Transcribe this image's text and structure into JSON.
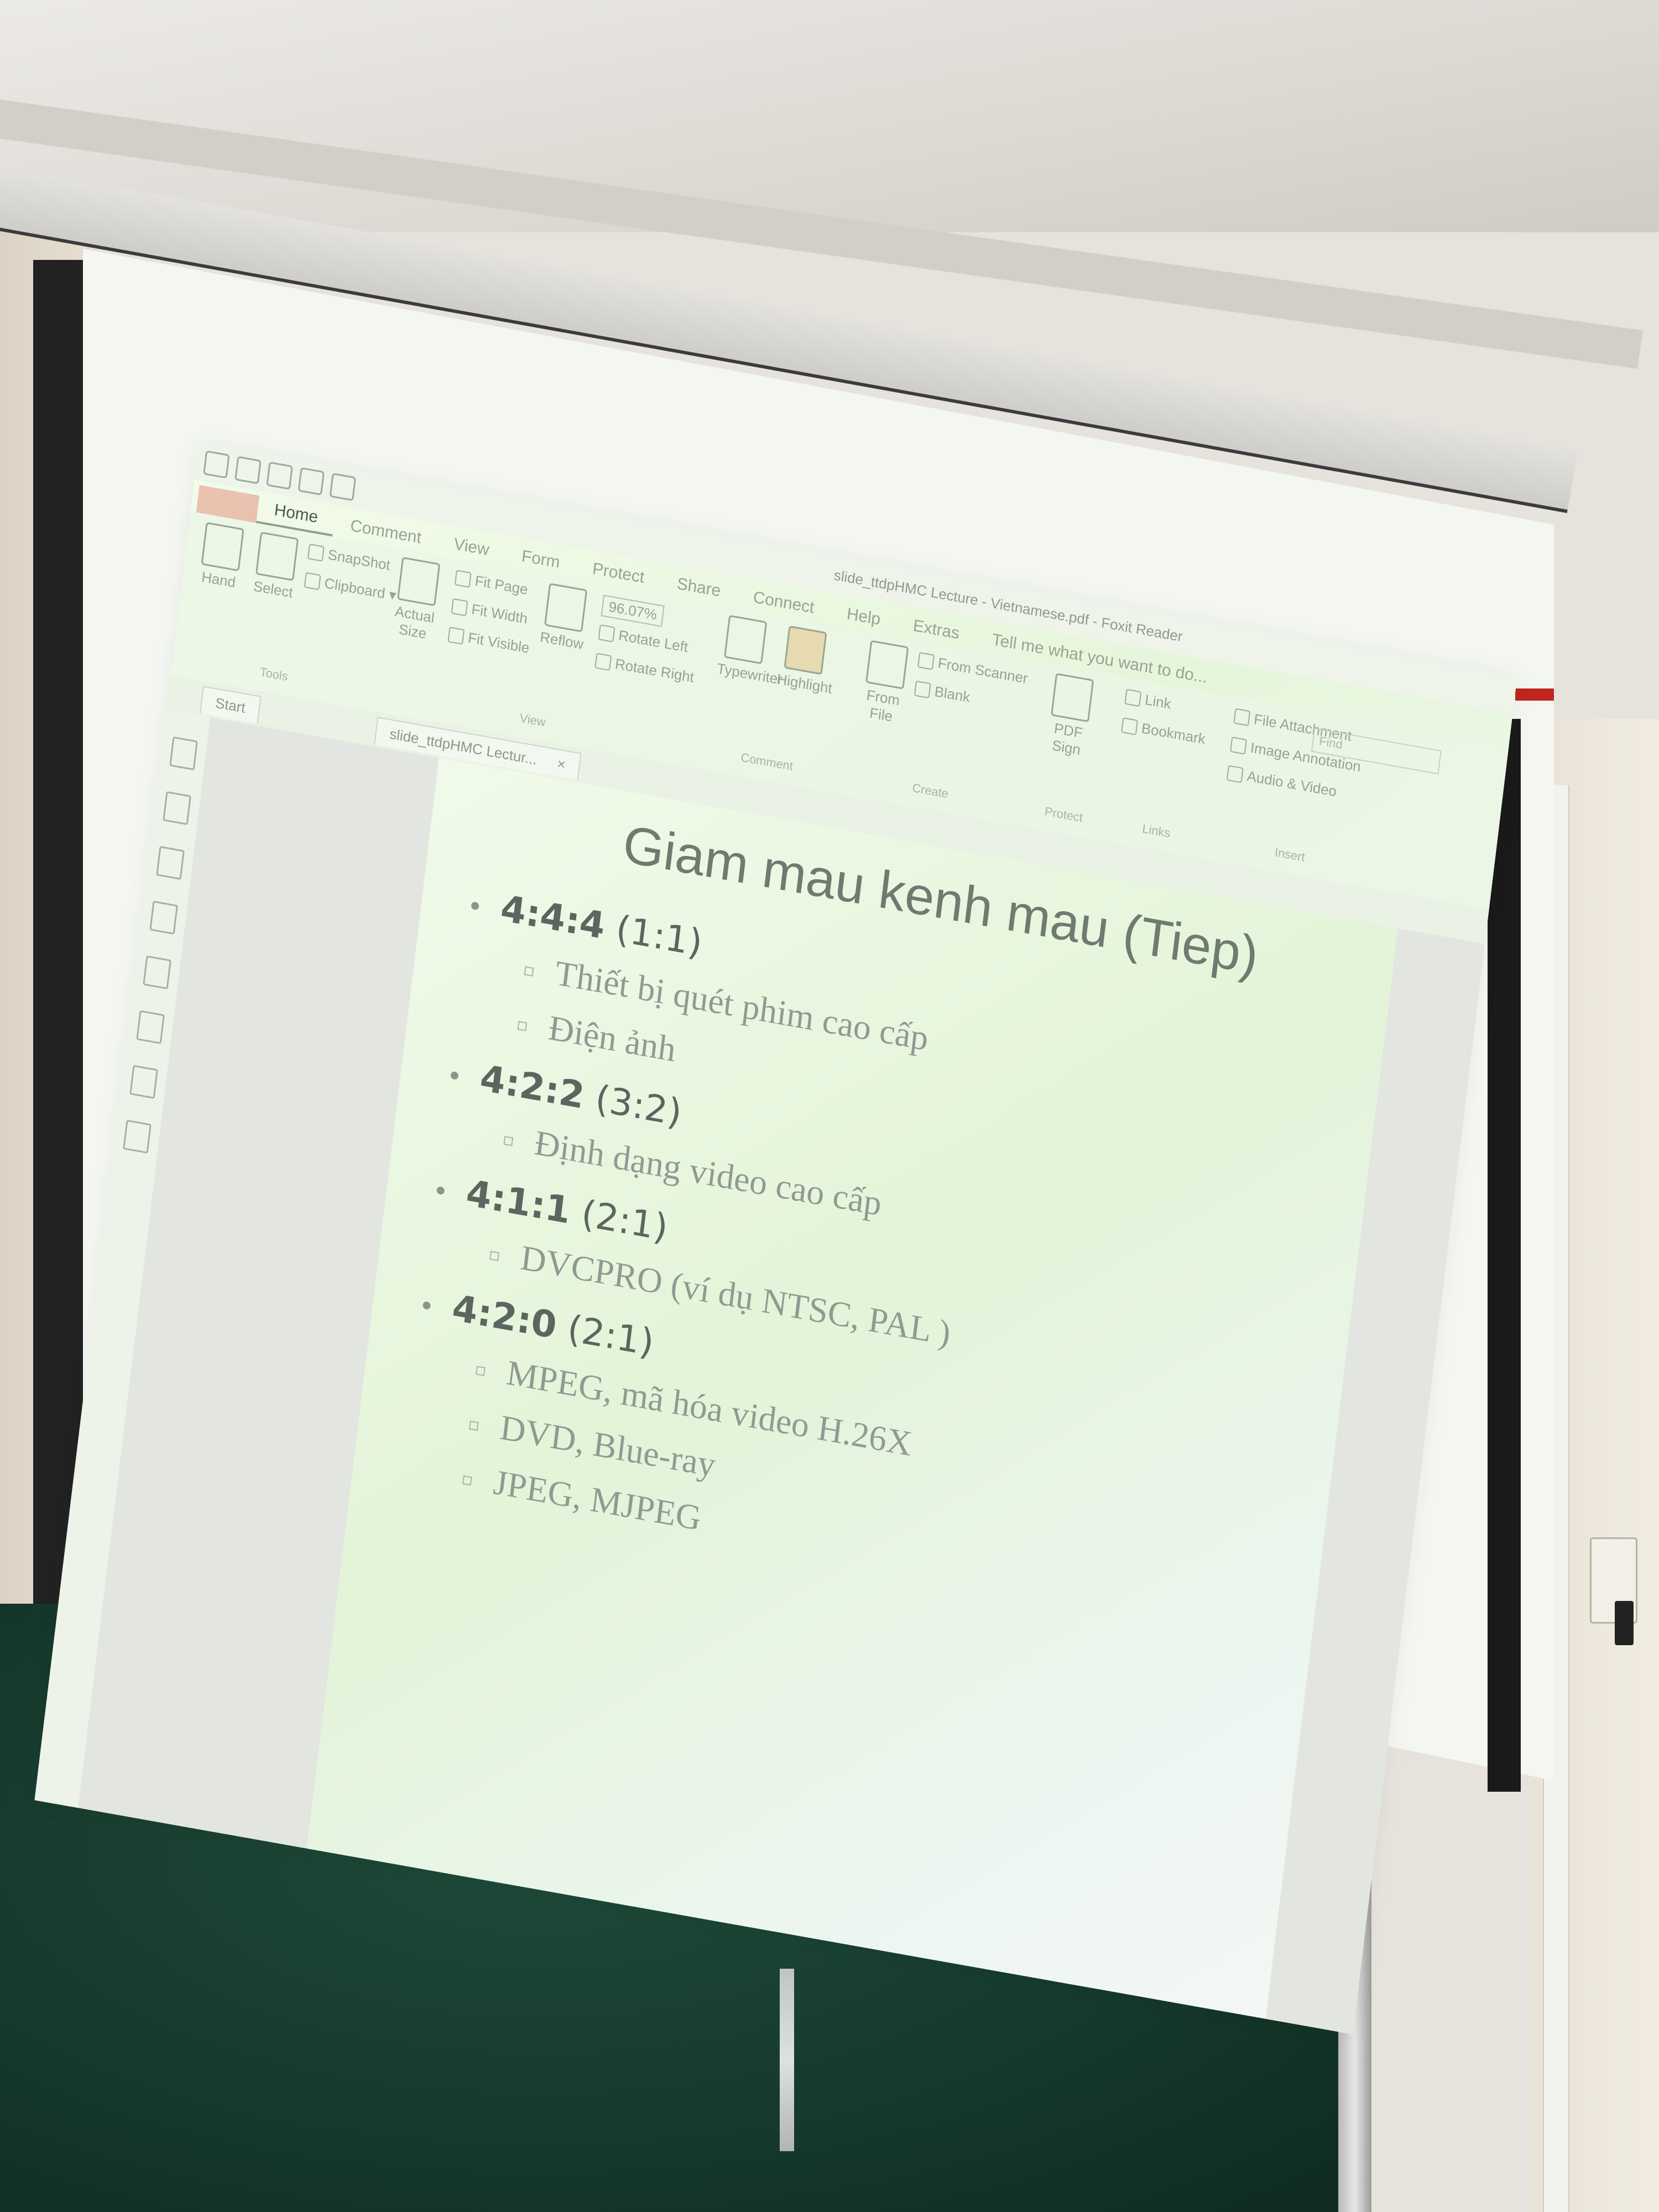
{
  "window": {
    "doc_title": "slide_ttdpHMC Lecture - Vietnamese.pdf - Foxit Reader",
    "tell_me": "Tell me what you want to do..."
  },
  "ribbon_tabs": [
    "Home",
    "Comment",
    "View",
    "Form",
    "Protect",
    "Share",
    "Connect",
    "Help",
    "Extras"
  ],
  "ribbon": {
    "hand": "Hand",
    "select": "Select",
    "snapshot": "SnapShot",
    "clipboard": "Clipboard ▾",
    "tools_group": "Tools",
    "actual_size": "Actual Size",
    "fit_page": "Fit Page",
    "fit_width": "Fit Width",
    "fit_visible": "Fit Visible",
    "reflow": "Reflow",
    "zoom": "96.07%",
    "rotate_left": "Rotate Left",
    "rotate_right": "Rotate Right",
    "view_group": "View",
    "typewriter": "Typewriter",
    "highlight": "Highlight",
    "comment_group": "Comment",
    "from_file": "From File",
    "from_scanner": "From Scanner",
    "blank": "Blank",
    "create_group": "Create",
    "pdf_sign": "PDF Sign",
    "protect_group": "Protect",
    "link": "Link",
    "bookmark": "Bookmark",
    "links_group": "Links",
    "file_attachment": "File Attachment",
    "image_annotation": "Image Annotation",
    "audio_video": "Audio & Video",
    "insert_group": "Insert",
    "find": "Find"
  },
  "tabs": {
    "start": "Start",
    "doc": "slide_ttdpHMC Lectur...",
    "close": "×"
  },
  "slide": {
    "title": "Giam mau kenh mau (Tiep)",
    "items": [
      {
        "key": "4:4:4",
        "ratio": "(1:1)",
        "subs": [
          "Thiết bị quét phim cao cấp",
          "Điện ảnh"
        ]
      },
      {
        "key": "4:2:2",
        "ratio": "(3:2)",
        "subs": [
          "Định dạng video cao cấp"
        ]
      },
      {
        "key": "4:1:1",
        "ratio": "(2:1)",
        "subs": [
          "DVCPRO (ví dụ NTSC, PAL )"
        ]
      },
      {
        "key": "4:2:0",
        "ratio": "(2:1)",
        "subs": [
          "MPEG, mã hóa video H.26X",
          "DVD, Blue-ray",
          "JPEG, MJPEG"
        ]
      }
    ]
  }
}
